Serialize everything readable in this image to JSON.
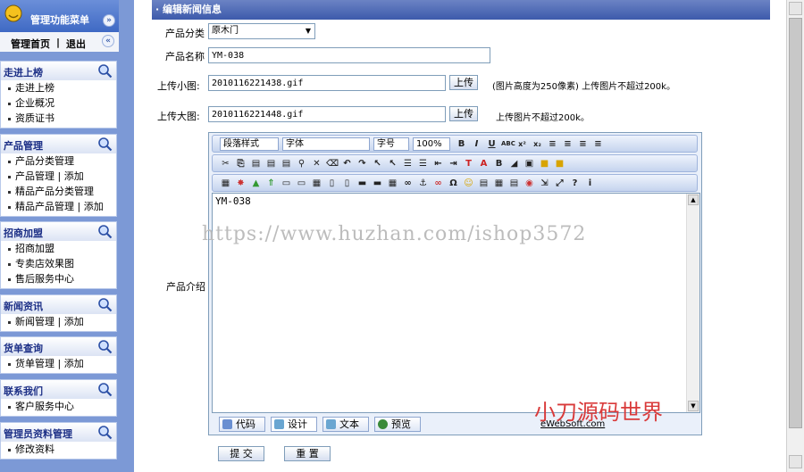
{
  "sidebar": {
    "title": "管理功能菜单",
    "nav_home": "管理首页",
    "nav_sep": "|",
    "nav_exit": "退出",
    "groups": [
      {
        "title": "走进上榜",
        "items": [
          "走进上榜",
          "企业概况",
          "资质证书"
        ]
      },
      {
        "title": "产品管理",
        "items": [
          "产品分类管理",
          "产品管理 | 添加",
          "精品产品分类管理",
          "精品产品管理 | 添加"
        ]
      },
      {
        "title": "招商加盟",
        "items": [
          "招商加盟",
          "专卖店效果图",
          "售后服务中心"
        ]
      },
      {
        "title": "新闻资讯",
        "items": [
          "新闻管理 | 添加"
        ]
      },
      {
        "title": "货单查询",
        "items": [
          "货单管理 | 添加"
        ]
      },
      {
        "title": "联系我们",
        "items": [
          "客户服务中心"
        ]
      },
      {
        "title": "管理员资料管理",
        "items": [
          "修改资料"
        ]
      }
    ]
  },
  "form": {
    "section_title": "· 编辑新闻信息",
    "category_label": "产品分类",
    "category_value": "原木门",
    "name_label": "产品名称",
    "name_value": "YM-038",
    "small_img_label": "上传小图:",
    "small_img_value": "2010116221438.gif",
    "upload_btn": "上传",
    "small_img_note": "(图片高度为250像素) 上传图片不超过200k。",
    "big_img_label": "上传大图:",
    "big_img_value": "2010116221448.gif",
    "big_img_note": "上传图片不超过200k。",
    "intro_label": "产品介绍",
    "submit_btn": "提 交",
    "reset_btn": "重 置"
  },
  "editor": {
    "para_style": "段落样式",
    "font": "字体",
    "size": "字号",
    "zoom": "100%",
    "content": "YM-038",
    "tab_code": "代码",
    "tab_design": "设计",
    "tab_text": "文本",
    "tab_preview": "预览",
    "brand": "eWebSoft.com"
  },
  "overlay": {
    "url": "https://www.huzhan.com/ishop3572",
    "stamp": "小刀源码世界"
  }
}
